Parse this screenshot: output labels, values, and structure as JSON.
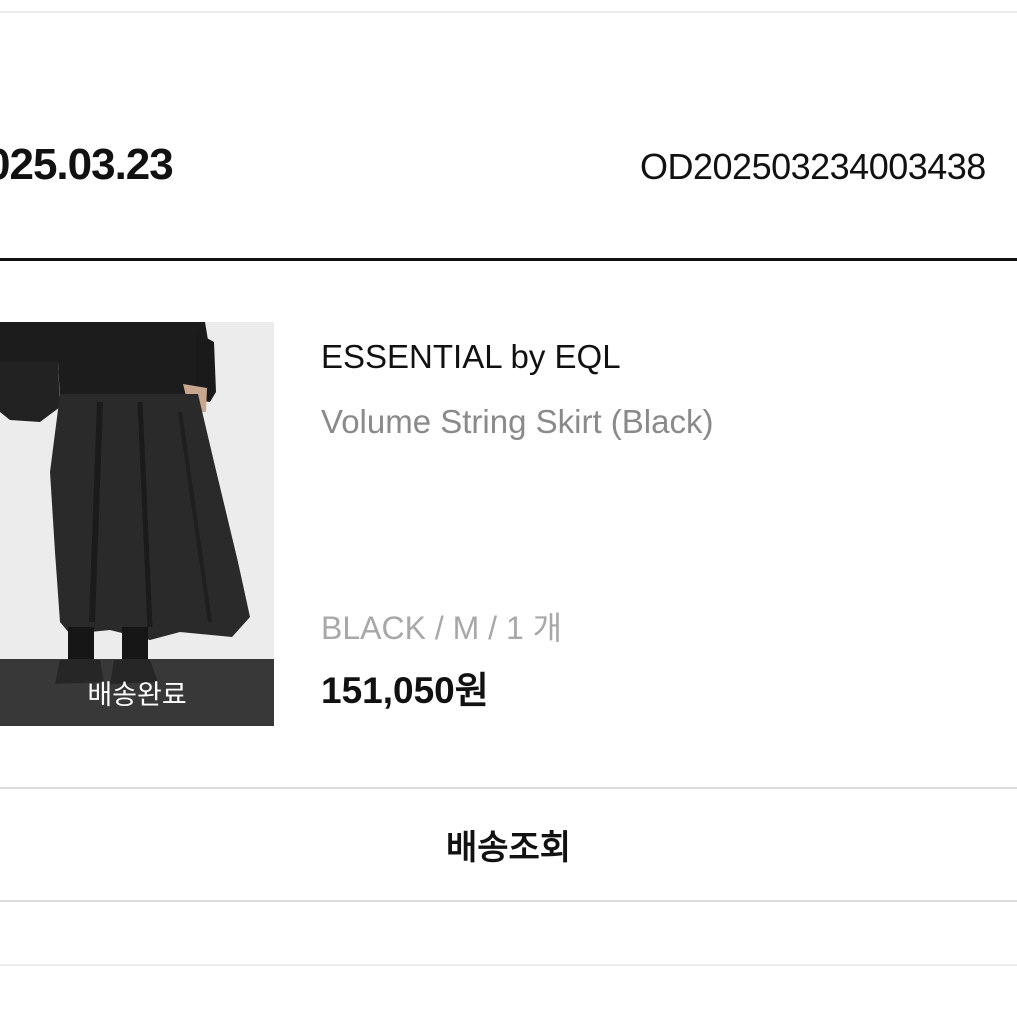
{
  "order": {
    "date": "025.03.23",
    "number": "OD202503234003438"
  },
  "item": {
    "brand": "ESSENTIAL by EQL",
    "name": "Volume String Skirt (Black)",
    "options": "BLACK / M / 1 개",
    "price": "151,050원",
    "status": "배송완료",
    "image_icon": "product-photo-black-skirt"
  },
  "actions": {
    "track_label": "배송조회"
  },
  "colors": {
    "divider_dark": "#111111",
    "divider_light": "#dcdcdc",
    "muted_text": "#8a8a8a",
    "options_text": "#a8a8a8",
    "status_overlay": "#282828"
  }
}
